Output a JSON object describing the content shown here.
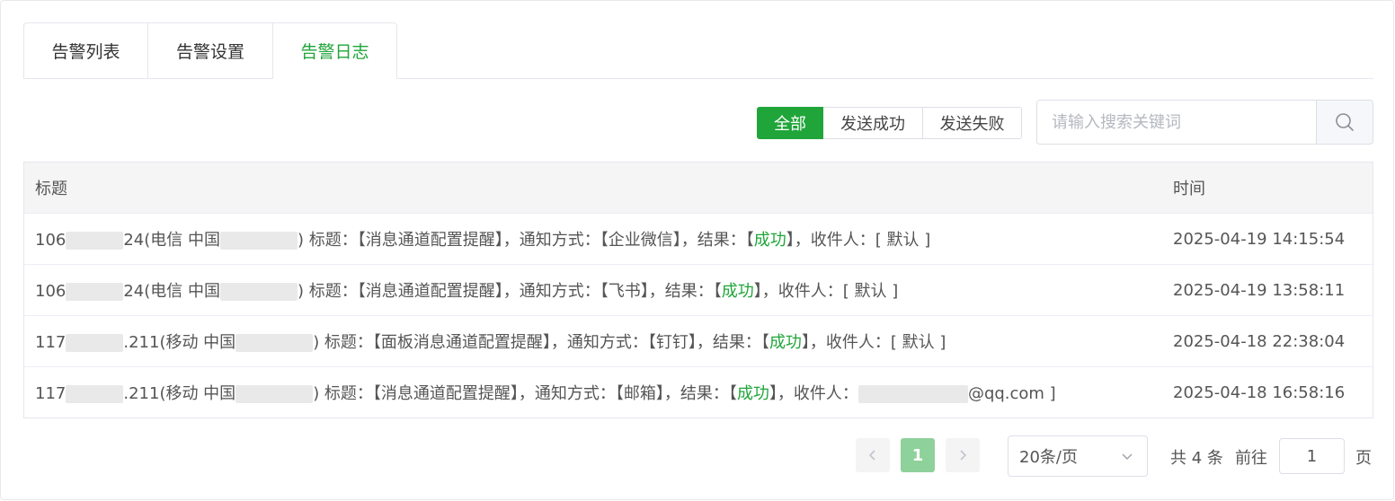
{
  "tabs": [
    {
      "label": "告警列表"
    },
    {
      "label": "告警设置"
    },
    {
      "label": "告警日志"
    }
  ],
  "filters": [
    {
      "label": "全部"
    },
    {
      "label": "发送成功"
    },
    {
      "label": "发送失败"
    }
  ],
  "search": {
    "placeholder": "请输入搜索关键词",
    "value": ""
  },
  "table": {
    "headers": [
      "标题",
      "时间"
    ],
    "rows": [
      {
        "ip_prefix": "106",
        "ip_suffix": "24(电信 中国",
        "close": ") 标题：【消息通道配置提醒】，通知方式：【企业微信】，结果：【",
        "result": "成功",
        "tail": "】，收件人：[ 默认 ]",
        "email": "",
        "time": "2025-04-19 14:15:54"
      },
      {
        "ip_prefix": "106",
        "ip_suffix": "24(电信 中国",
        "close": ") 标题：【消息通道配置提醒】，通知方式：【飞书】，结果：【",
        "result": "成功",
        "tail": "】，收件人：[ 默认 ]",
        "email": "",
        "time": "2025-04-19 13:58:11"
      },
      {
        "ip_prefix": "117",
        "ip_suffix": ".211(移动 中国",
        "close": ") 标题：【面板消息通道配置提醒】，通知方式：【钉钉】，结果：【",
        "result": "成功",
        "tail": "】，收件人：[ 默认 ]",
        "email": "",
        "time": "2025-04-18 22:38:04"
      },
      {
        "ip_prefix": "117",
        "ip_suffix": ".211(移动 中国",
        "close": ") 标题：【消息通道配置提醒】，通知方式：【邮箱】，结果：【",
        "result": "成功",
        "tail": "】，收件人：",
        "email": "@qq.com ]",
        "time": "2025-04-18 16:58:16"
      }
    ]
  },
  "pagination": {
    "current_page": "1",
    "page_size": "20条/页",
    "total_text": "共 4 条",
    "goto_label": "前往",
    "goto_value": "1",
    "page_suffix": "页"
  },
  "colors": {
    "accent": "#20a53a",
    "accent_light": "#8fd19a"
  },
  "icons": {
    "search": "search-icon",
    "prev": "chevron-left-icon",
    "next": "chevron-right-icon",
    "dropdown": "chevron-down-icon"
  }
}
